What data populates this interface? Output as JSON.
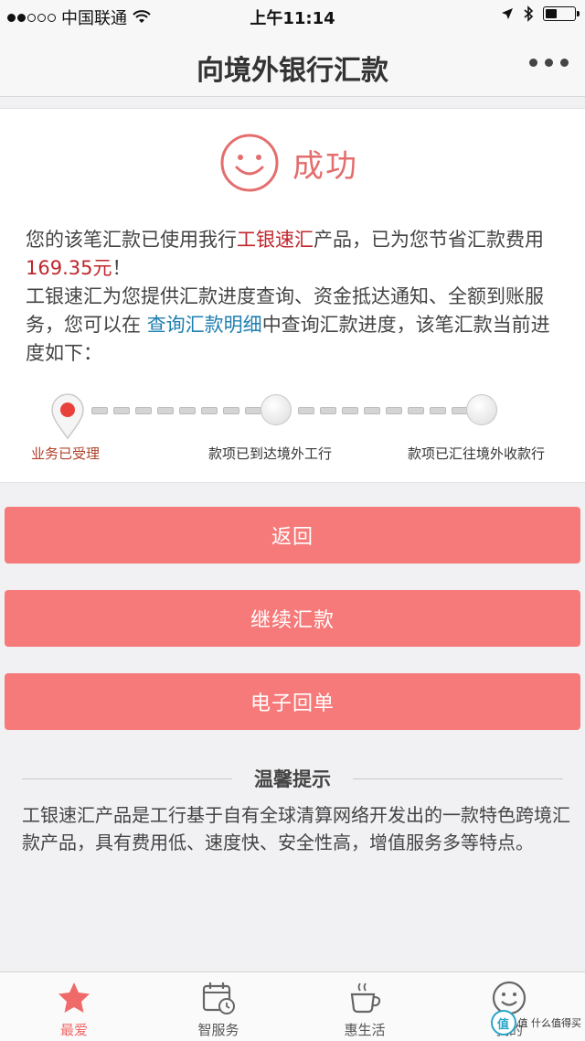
{
  "status_bar": {
    "carrier": "中国联通",
    "time": "上午11:14"
  },
  "nav": {
    "title": "向境外银行汇款"
  },
  "result": {
    "status_text": "成功",
    "msg_part1": "您的该笔汇款已使用我行",
    "product_name": "工银速汇",
    "msg_part2": "产品，已为您节省汇款费用",
    "saved_amount": "169.35元",
    "msg_part3": "！",
    "msg_part4": "工银速汇为您提供汇款进度查询、资金抵达通知、全额到账服务，您可以在 ",
    "detail_link": "查询汇款明细",
    "msg_part5": "中查询汇款进度，该笔汇款当前进度如下："
  },
  "progress": {
    "steps": [
      {
        "label": "业务已受理",
        "state": "done"
      },
      {
        "label": "款项已到达境外工行",
        "state": "pending"
      },
      {
        "label": "款项已汇往境外收款行",
        "state": "pending"
      }
    ]
  },
  "buttons": {
    "back": "返回",
    "continue": "继续汇款",
    "receipt": "电子回单"
  },
  "tips": {
    "title": "温馨提示",
    "body": "工银速汇产品是工行基于自有全球清算网络开发出的一款特色跨境汇款产品，具有费用低、速度快、安全性高，增值服务多等特点。"
  },
  "tab_bar": {
    "tabs": [
      {
        "label": "最爱",
        "icon": "star-icon",
        "active": true
      },
      {
        "label": "智服务",
        "icon": "calendar-clock-icon",
        "active": false
      },
      {
        "label": "惠生活",
        "icon": "coffee-cup-icon",
        "active": false
      },
      {
        "label": "我的",
        "icon": "smiley-icon",
        "active": false
      }
    ]
  },
  "watermark": {
    "text": "值 什么值得买",
    "badge": "值"
  },
  "colors": {
    "accent": "#f77a7a",
    "success": "#e46e6e",
    "highlight_red": "#c0262c",
    "link_blue": "#1f7fb0"
  }
}
